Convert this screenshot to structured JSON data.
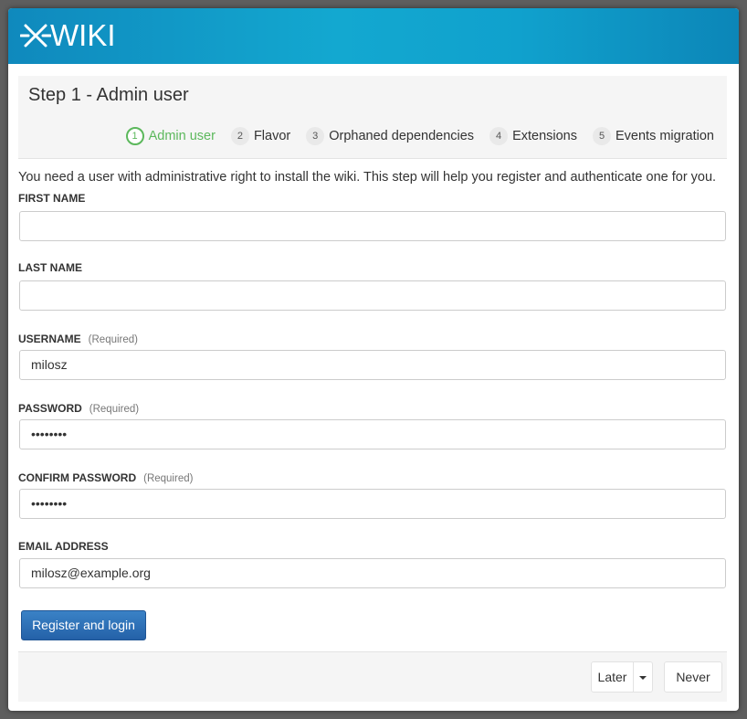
{
  "header": {
    "logo_text": "WIKI",
    "logo_icon": "xwiki-x-icon"
  },
  "step_panel": {
    "title": "Step 1 - Admin user",
    "steps": [
      {
        "num": "1",
        "label": "Admin user",
        "active": true
      },
      {
        "num": "2",
        "label": "Flavor"
      },
      {
        "num": "3",
        "label": "Orphaned dependencies"
      },
      {
        "num": "4",
        "label": "Extensions"
      },
      {
        "num": "5",
        "label": "Events migration"
      }
    ]
  },
  "form": {
    "intro": "You need a user with administrative right to install the wiki. This step will help you register and authenticate one for you.",
    "first_name": {
      "label": "FIRST NAME",
      "value": ""
    },
    "last_name": {
      "label": "LAST NAME",
      "value": ""
    },
    "username": {
      "label": "USERNAME",
      "required": "(Required)",
      "value": "milosz"
    },
    "password": {
      "label": "PASSWORD",
      "required": "(Required)",
      "value": "••••••••"
    },
    "confirm_password": {
      "label": "CONFIRM PASSWORD",
      "required": "(Required)",
      "value": "••••••••"
    },
    "email": {
      "label": "EMAIL ADDRESS",
      "value": "milosz@example.org"
    },
    "submit_label": "Register and login"
  },
  "footer": {
    "later_label": "Later",
    "never_label": "Never"
  },
  "colors": {
    "brand": "#13a8d0",
    "active_step": "#5cb85c",
    "primary_button": "#2d70b5"
  }
}
